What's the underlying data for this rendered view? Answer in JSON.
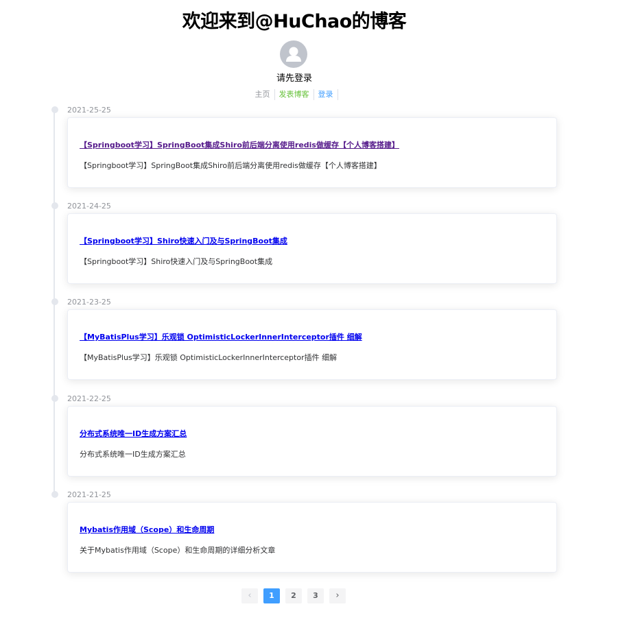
{
  "header": {
    "site_title": "欢迎来到@HuChao的博客",
    "login_hint": "请先登录"
  },
  "nav": {
    "home": "主页",
    "publish": "发表博客",
    "login": "登录"
  },
  "posts": [
    {
      "date": "2021-25-25",
      "title": "【Springboot学习】SpringBoot集成Shiro前后端分离使用redis做缓存【个人博客搭建】",
      "desc": "【Springboot学习】SpringBoot集成Shiro前后端分离使用redis做缓存【个人博客搭建】"
    },
    {
      "date": "2021-24-25",
      "title": "【Springboot学习】Shiro快速入门及与SpringBoot集成",
      "desc": "【Springboot学习】Shiro快速入门及与SpringBoot集成"
    },
    {
      "date": "2021-23-25",
      "title": "【MyBatisPlus学习】乐观锁 OptimisticLockerInnerInterceptor插件 细解",
      "desc": "【MyBatisPlus学习】乐观锁 OptimisticLockerInnerInterceptor插件 细解"
    },
    {
      "date": "2021-22-25",
      "title": "分布式系统唯一ID生成方案汇总",
      "desc": "分布式系统唯一ID生成方案汇总"
    },
    {
      "date": "2021-21-25",
      "title": "Mybatis作用域（Scope）和生命周期",
      "desc": "关于Mybatis作用域（Scope）和生命周期的详细分析文章"
    }
  ],
  "pagination": {
    "prev": "‹",
    "pages": [
      "1",
      "2",
      "3"
    ],
    "current": "1",
    "next": "›"
  },
  "colors": {
    "accent": "#409eff",
    "publish": "#67c23a",
    "muted": "#909399"
  }
}
